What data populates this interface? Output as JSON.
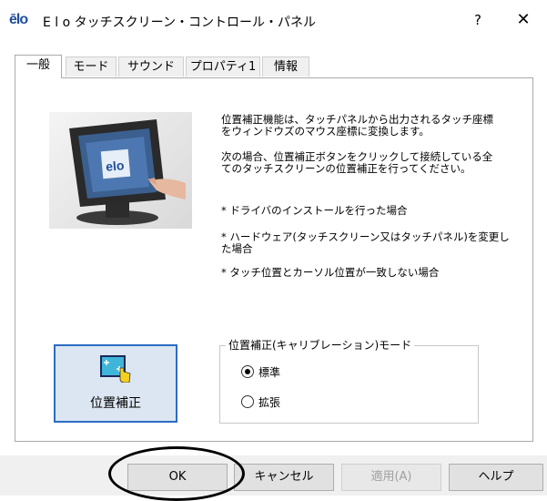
{
  "window": {
    "logo_text": "ēlo",
    "title": "E l o タッチスクリーン・コントロール・パネル",
    "help_label": "?",
    "close_label": "✕"
  },
  "tabs": [
    {
      "label": "一般",
      "active": true
    },
    {
      "label": "モード",
      "active": false
    },
    {
      "label": "サウンド",
      "active": false
    },
    {
      "label": "プロパティ1",
      "active": false
    },
    {
      "label": "情報",
      "active": false
    }
  ],
  "general": {
    "description_line1": "位置補正機能は、タッチパネルから出力されるタッチ座標",
    "description_line2": "をウィンドウズのマウス座標に変換します。",
    "instruction_line1": "次の場合、位置補正ボタンをクリックして接続している全",
    "instruction_line2": "てのタッチスクリーンの位置補正を行ってください。",
    "bullet1": "* ドライバのインストールを行った場合",
    "bullet2_line1": "* ハードウェア(タッチスクリーン又はタッチパネル)を変更し",
    "bullet2_line2": "た場合",
    "bullet3": "* タッチ位置とカーソル位置が一致しない場合",
    "calibrate_button_label": "位置補正",
    "calibrate_icon": "touch-calibration-icon",
    "monitor_logo_text": "elo",
    "mode_group_title": "位置補正(キャリブレーション)モード",
    "mode_options": [
      {
        "label": "標準",
        "checked": true
      },
      {
        "label": "拡張",
        "checked": false
      }
    ]
  },
  "footer_buttons": {
    "ok": "OK",
    "cancel": "キャンセル",
    "apply": "適用(A)",
    "help": "ヘルプ"
  },
  "colors": {
    "accent_blue": "#2b6cc4",
    "logo_blue": "#1f4e9a",
    "disabled_text": "#a0a0a0"
  }
}
